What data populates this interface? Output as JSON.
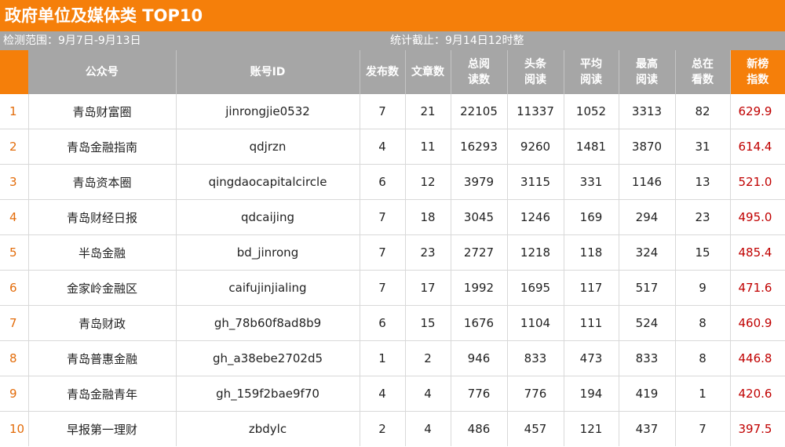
{
  "header": {
    "title": "政府单位及媒体类 TOP10",
    "range_label": "检测范围：9月7日-9月13日",
    "deadline_label": "统计截止：9月14日12时整"
  },
  "table": {
    "columns": {
      "rank": "",
      "account": "公众号",
      "id": "账号ID",
      "posts": "发布数",
      "articles": "文章数",
      "total_reads_1": "总阅",
      "total_reads_2": "读数",
      "head_reads_1": "头条",
      "head_reads_2": "阅读",
      "avg_reads_1": "平均",
      "avg_reads_2": "阅读",
      "max_reads_1": "最高",
      "max_reads_2": "阅读",
      "watching_1": "总在",
      "watching_2": "看数",
      "score_1": "新榜",
      "score_2": "指数"
    },
    "rows": [
      {
        "rank": "1",
        "name": "青岛财富圈",
        "id": "jinrongjie0532",
        "posts": "7",
        "articles": "21",
        "total": "22105",
        "head": "11337",
        "avg": "1052",
        "max": "3313",
        "watch": "82",
        "score": "629.9"
      },
      {
        "rank": "2",
        "name": "青岛金融指南",
        "id": "qdjrzn",
        "posts": "4",
        "articles": "11",
        "total": "16293",
        "head": "9260",
        "avg": "1481",
        "max": "3870",
        "watch": "31",
        "score": "614.4"
      },
      {
        "rank": "3",
        "name": "青岛资本圈",
        "id": "qingdaocapitalcircle",
        "posts": "6",
        "articles": "12",
        "total": "3979",
        "head": "3115",
        "avg": "331",
        "max": "1146",
        "watch": "13",
        "score": "521.0"
      },
      {
        "rank": "4",
        "name": "青岛财经日报",
        "id": "qdcaijing",
        "posts": "7",
        "articles": "18",
        "total": "3045",
        "head": "1246",
        "avg": "169",
        "max": "294",
        "watch": "23",
        "score": "495.0"
      },
      {
        "rank": "5",
        "name": "半岛金融",
        "id": "bd_jinrong",
        "posts": "7",
        "articles": "23",
        "total": "2727",
        "head": "1218",
        "avg": "118",
        "max": "324",
        "watch": "15",
        "score": "485.4"
      },
      {
        "rank": "6",
        "name": "金家岭金融区",
        "id": "caifujinjialing",
        "posts": "7",
        "articles": "17",
        "total": "1992",
        "head": "1695",
        "avg": "117",
        "max": "517",
        "watch": "9",
        "score": "471.6"
      },
      {
        "rank": "7",
        "name": "青岛财政",
        "id": "gh_78b60f8ad8b9",
        "posts": "6",
        "articles": "15",
        "total": "1676",
        "head": "1104",
        "avg": "111",
        "max": "524",
        "watch": "8",
        "score": "460.9"
      },
      {
        "rank": "8",
        "name": "青岛普惠金融",
        "id": "gh_a38ebe2702d5",
        "posts": "1",
        "articles": "2",
        "total": "946",
        "head": "833",
        "avg": "473",
        "max": "833",
        "watch": "8",
        "score": "446.8"
      },
      {
        "rank": "9",
        "name": "青岛金融青年",
        "id": "gh_159f2bae9f70",
        "posts": "4",
        "articles": "4",
        "total": "776",
        "head": "776",
        "avg": "194",
        "max": "419",
        "watch": "1",
        "score": "420.6"
      },
      {
        "rank": "10",
        "name": "早报第一理财",
        "id": "zbdylc",
        "posts": "2",
        "articles": "4",
        "total": "486",
        "head": "457",
        "avg": "121",
        "max": "437",
        "watch": "7",
        "score": "397.5"
      }
    ]
  },
  "colors": {
    "accent": "#f57f0a",
    "header_gray": "#a6a6a6",
    "score_red": "#c00000",
    "rank_orange": "#e36c0a"
  }
}
